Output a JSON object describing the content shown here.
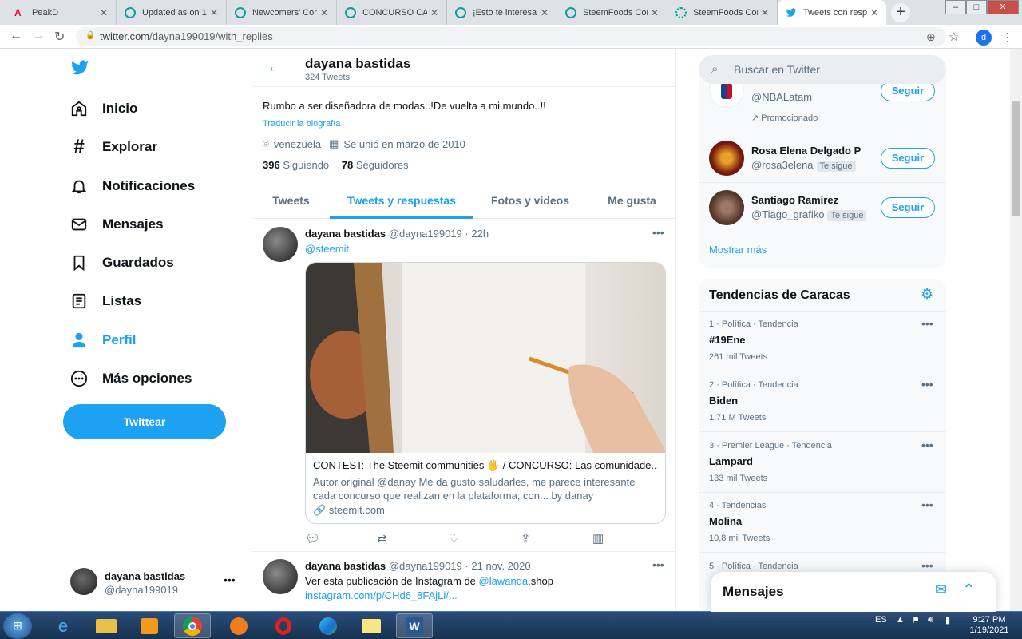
{
  "browser": {
    "tabs": [
      {
        "title": "PeakD",
        "icon": "peakd-icon",
        "active": false
      },
      {
        "title": "Updated as on 1(",
        "icon": "steem-icon",
        "active": false
      },
      {
        "title": "Newcomers' Com",
        "icon": "steem-icon",
        "active": false
      },
      {
        "title": "CONCURSO CAS",
        "icon": "steem-icon",
        "active": false
      },
      {
        "title": "¡Esto te interesa!",
        "icon": "steem-icon",
        "active": false
      },
      {
        "title": "SteemFoods Com",
        "icon": "steem-icon",
        "active": false
      },
      {
        "title": "SteemFoods Com",
        "icon": "steem-loading-icon",
        "active": false
      },
      {
        "title": "Tweets con resp",
        "icon": "twitter-icon",
        "active": true
      }
    ],
    "url_host": "twitter.com",
    "url_path": "/dayna199019/with_replies",
    "profile_letter": "d"
  },
  "nav": {
    "items": [
      {
        "label": "Inicio",
        "icon": "home-icon"
      },
      {
        "label": "Explorar",
        "icon": "hashtag-icon"
      },
      {
        "label": "Notificaciones",
        "icon": "bell-icon"
      },
      {
        "label": "Mensajes",
        "icon": "mail-icon"
      },
      {
        "label": "Guardados",
        "icon": "bookmark-icon"
      },
      {
        "label": "Listas",
        "icon": "list-icon"
      },
      {
        "label": "Perfil",
        "icon": "user-icon",
        "active": true
      },
      {
        "label": "Más opciones",
        "icon": "more-circle-icon"
      }
    ],
    "tweet_button": "Twittear",
    "account": {
      "name": "dayana bastidas",
      "handle": "@dayna199019"
    }
  },
  "profile": {
    "name": "dayana bastidas",
    "tweet_count": "324 Tweets",
    "bio": "Rumbo a ser diseñadora de modas..!De vuelta a mi mundo..!!",
    "translate": "Traducir la biografía",
    "location": "venezuela",
    "joined": "Se unió en marzo de 2010",
    "following_count": "396",
    "following_label": "Siguiendo",
    "followers_count": "78",
    "followers_label": "Seguidores",
    "tabs": [
      "Tweets",
      "Tweets y respuestas",
      "Fotos y videos",
      "Me gusta"
    ],
    "active_tab": 1
  },
  "tweets": [
    {
      "name": "dayana bastidas",
      "handle": "@dayna199019",
      "time": "22h",
      "text": "@steemit",
      "card": {
        "title": "CONTEST: The Steemit communities 🖐 / CONCURSO: Las comunidade...",
        "desc": "Autor original @danay Me da gusto saludarles, me parece interesante cada concurso que realizan en la plataforma, con... by danay",
        "domain": "steemit.com"
      }
    },
    {
      "name": "dayana bastidas",
      "handle": "@dayna199019",
      "time": "21 nov. 2020",
      "text_pre": "Ver esta publicación de Instagram de ",
      "text_link": "@lawanda",
      "text_post": ".shop",
      "link": "instagram.com/p/CHd6_8FAjLi/..."
    }
  ],
  "search_placeholder": "Buscar en Twitter",
  "who_to_follow": [
    {
      "handle": "@NBALatam",
      "promo": "Promocionado",
      "button": "Seguir"
    },
    {
      "name": "Rosa Elena Delgado P",
      "handle": "@rosa3elena",
      "badge": "Te sigue",
      "button": "Seguir"
    },
    {
      "name": "Santiago Ramirez",
      "handle": "@Tiago_grafiko",
      "badge": "Te sigue",
      "button": "Seguir"
    }
  ],
  "show_more": "Mostrar más",
  "trends": {
    "title": "Tendencias de Caracas",
    "items": [
      {
        "ctx": "1 · Política · Tendencia",
        "name": "#19Ene",
        "count": "261 mil Tweets"
      },
      {
        "ctx": "2 · Política · Tendencia",
        "name": "Biden",
        "count": "1,71 M Tweets"
      },
      {
        "ctx": "3 · Premier League · Tendencia",
        "name": "Lampard",
        "count": "133 mil Tweets"
      },
      {
        "ctx": "4 · Tendencias",
        "name": "Molina",
        "count": "10,8 mil Tweets"
      },
      {
        "ctx": "5 · Política · Tendencia",
        "name": "",
        "count": ""
      }
    ]
  },
  "messages_title": "Mensajes",
  "taskbar": {
    "lang": "ES",
    "time": "9:27 PM",
    "date": "1/19/2021"
  },
  "colors": {
    "accent": "#1da1f2",
    "text": "#0f1419",
    "secondary": "#5b7083"
  }
}
